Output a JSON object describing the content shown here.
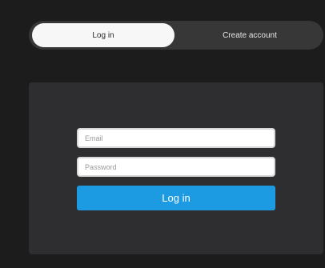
{
  "tabs": {
    "login_label": "Log in",
    "create_label": "Create account"
  },
  "form": {
    "email_placeholder": "Email",
    "password_placeholder": "Password",
    "submit_label": "Log in"
  },
  "colors": {
    "background": "#1c1c1c",
    "tabbar": "#373737",
    "active_tab": "#f7f7f7",
    "panel": "#2e2e30",
    "accent": "#1d9be2"
  }
}
